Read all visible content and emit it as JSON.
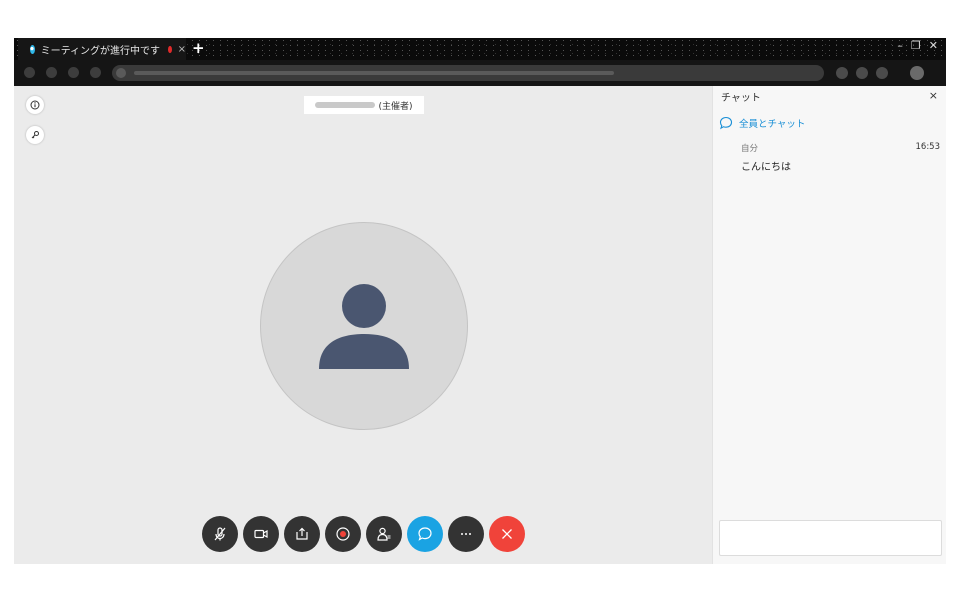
{
  "browser": {
    "tab": {
      "title": "ミーティングが進行中です",
      "close": "×"
    },
    "new_tab": "+",
    "window_controls": {
      "minimize": "–",
      "restore": "❐",
      "close": "✕"
    }
  },
  "meeting": {
    "host_suffix": "(主催者)",
    "controls": [
      {
        "name": "mute-button",
        "icon": "mic-off-icon"
      },
      {
        "name": "video-button",
        "icon": "video-camera-icon"
      },
      {
        "name": "share-button",
        "icon": "share-icon"
      },
      {
        "name": "record-button",
        "icon": "record-icon"
      },
      {
        "name": "participants-button",
        "icon": "participants-icon"
      },
      {
        "name": "chat-button",
        "icon": "chat-bubble-icon",
        "color": "#1aa3e3"
      },
      {
        "name": "more-button",
        "icon": "more-icon"
      },
      {
        "name": "leave-button",
        "icon": "close-icon",
        "color": "#f0433a"
      }
    ]
  },
  "chat": {
    "header": "チャット",
    "close": "×",
    "target": "全員とチャット",
    "messages": [
      {
        "sender": "自分",
        "time": "16:53",
        "text": "こんにちは"
      }
    ]
  },
  "colors": {
    "accent": "#1aa3e3",
    "danger": "#f0433a",
    "avatar_figure": "#4a5670"
  }
}
